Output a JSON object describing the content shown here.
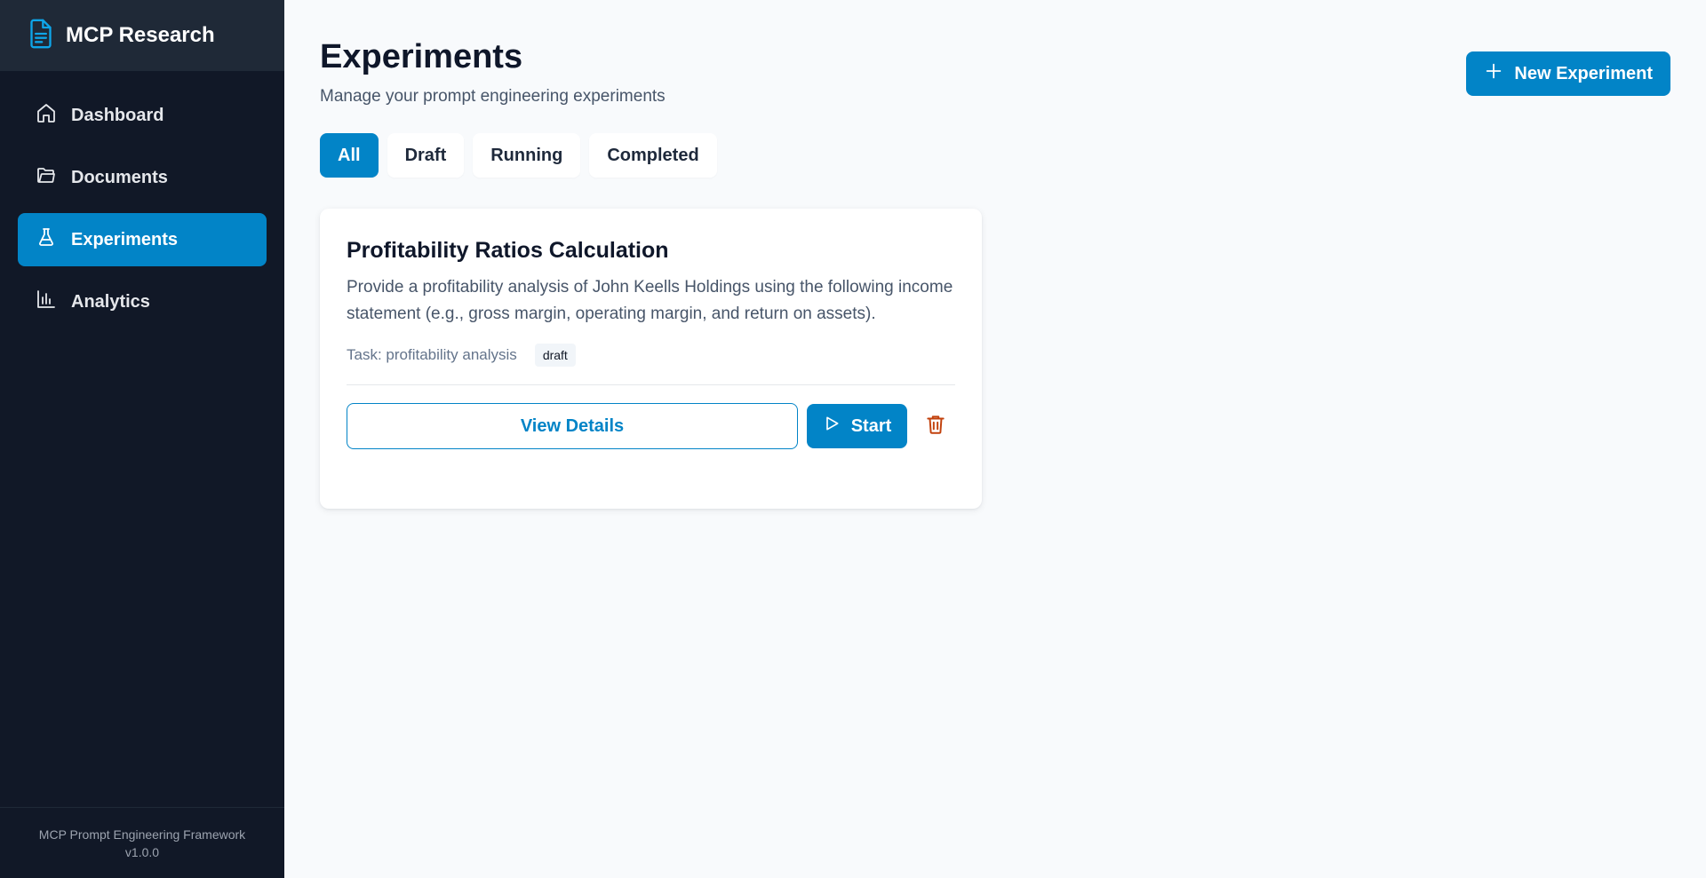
{
  "app": {
    "title": "MCP Research",
    "footer_line1": "MCP Prompt Engineering Framework",
    "footer_line2": "v1.0.0"
  },
  "sidebar": {
    "items": [
      {
        "label": "Dashboard",
        "icon": "home-icon",
        "active": false
      },
      {
        "label": "Documents",
        "icon": "folder-icon",
        "active": false
      },
      {
        "label": "Experiments",
        "icon": "flask-icon",
        "active": true
      },
      {
        "label": "Analytics",
        "icon": "bar-chart-icon",
        "active": false
      }
    ]
  },
  "header": {
    "title": "Experiments",
    "subtitle": "Manage your prompt engineering experiments",
    "new_button_label": "New Experiment"
  },
  "filters": [
    {
      "label": "All",
      "active": true
    },
    {
      "label": "Draft",
      "active": false
    },
    {
      "label": "Running",
      "active": false
    },
    {
      "label": "Completed",
      "active": false
    }
  ],
  "experiments": [
    {
      "title": "Profitability Ratios Calculation",
      "description": "Provide a profitability analysis of John Keells Holdings using the following income statement (e.g., gross margin, operating margin, and return on assets).",
      "task": "Task: profitability analysis",
      "status": "draft",
      "view_label": "View Details",
      "start_label": "Start"
    }
  ],
  "colors": {
    "accent": "#0284c7",
    "sidebar_bg": "#111827",
    "brand_bg": "#1f2937",
    "danger": "#dc2626"
  }
}
